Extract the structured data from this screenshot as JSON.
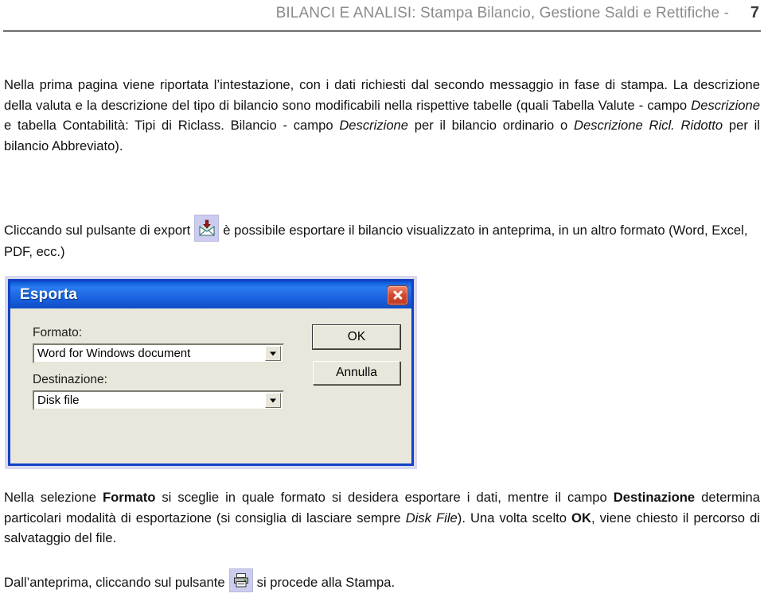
{
  "header": {
    "title": "BILANCI E ANALISI: Stampa Bilancio, Gestione Saldi e Rettifiche  -",
    "page_number": "7"
  },
  "paragraphs": {
    "intro_part1": "Nella prima pagina viene riportata l’intestazione, con i dati richiesti dal secondo messaggio in fase di stampa. La descrizione della valuta e la descrizione del tipo di bilancio sono modificabili nella rispettive tabelle (quali Tabella Valute - campo ",
    "intro_em1": "Descrizione",
    "intro_part2": " e tabella Contabilità: Tipi di Riclass. Bilancio - campo ",
    "intro_em2": "Descrizione",
    "intro_part3": " per il bilancio ordinario o ",
    "intro_em3": "Descrizione Ricl. Ridotto",
    "intro_part4": " per il bilancio Abbreviato).",
    "export_part1": "Cliccando sul pulsante di export",
    "export_part2": "è possibile esportare il bilancio visualizzato in anteprima, in un altro formato (Word, Excel, PDF, ecc.)",
    "format_part1": "Nella selezione ",
    "format_strong1": "Formato",
    "format_part2": " si sceglie in quale formato si desidera esportare i dati, mentre il campo ",
    "format_strong2": "Destinazione",
    "format_part3": " determina particolari modalità di esportazione (si consiglia di lasciare sempre ",
    "format_em1": "Disk File",
    "format_part4": "). Una volta scelto ",
    "format_strong3": "OK",
    "format_part5": ", viene chiesto il percorso di salvataggio del file.",
    "print_part1": "Dall’anteprima, cliccando sul pulsante",
    "print_part2": "si procede alla Stampa."
  },
  "icons": {
    "export_button": "export-envelope-icon",
    "print_button": "printer-icon",
    "close_button": "close-icon",
    "dropdown": "chevron-down-icon"
  },
  "dialog": {
    "title": "Esporta",
    "format_label": "Formato:",
    "format_value": "Word for Windows document",
    "destination_label": "Destinazione:",
    "destination_value": "Disk file",
    "ok_label": "OK",
    "cancel_label": "Annulla"
  },
  "colors": {
    "titlebar_blue": "#1b64e2",
    "dialog_face": "#e9e7db",
    "close_red": "#d6472c",
    "header_gray": "#8c8c8c",
    "icon_button_lavender": "#ccccee"
  }
}
